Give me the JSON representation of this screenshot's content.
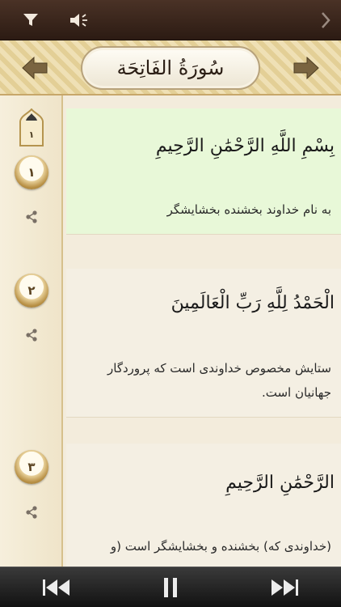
{
  "header": {
    "surah_title": "سُورَةُ الفَاتِحَة"
  },
  "rail": {
    "juz_number": "١"
  },
  "verses": [
    {
      "number": "١",
      "arabic": "بِسْمِ اللَّهِ الرَّحْمَٰنِ الرَّحِيمِ",
      "translation": "به نام خداوند بخشنده بخشایشگر"
    },
    {
      "number": "٢",
      "arabic": "الْحَمْدُ لِلَّهِ رَبِّ الْعَالَمِينَ",
      "translation": "ستایش مخصوص خداوندی است که پروردگار جهانیان است."
    },
    {
      "number": "٣",
      "arabic": "الرَّحْمَٰنِ الرَّحِيمِ",
      "translation": "(خداوندی که) بخشنده و بخشایشگر است (و"
    }
  ],
  "icons": {
    "filter": "filter-icon",
    "sound": "speaker-icon",
    "next_page": "chevron-right-icon",
    "prev_surah": "arrow-left-icon",
    "next_surah": "arrow-right-icon",
    "share": "share-icon",
    "prev_track": "skip-previous-icon",
    "pause": "pause-icon",
    "next_track": "skip-next-icon"
  },
  "colors": {
    "toolbar": "#3a251b",
    "active_verse": "#e8f8d8",
    "verse_bg": "#f4efe3",
    "header_pattern": "#e3cf96",
    "player": "#1e1e1e"
  }
}
